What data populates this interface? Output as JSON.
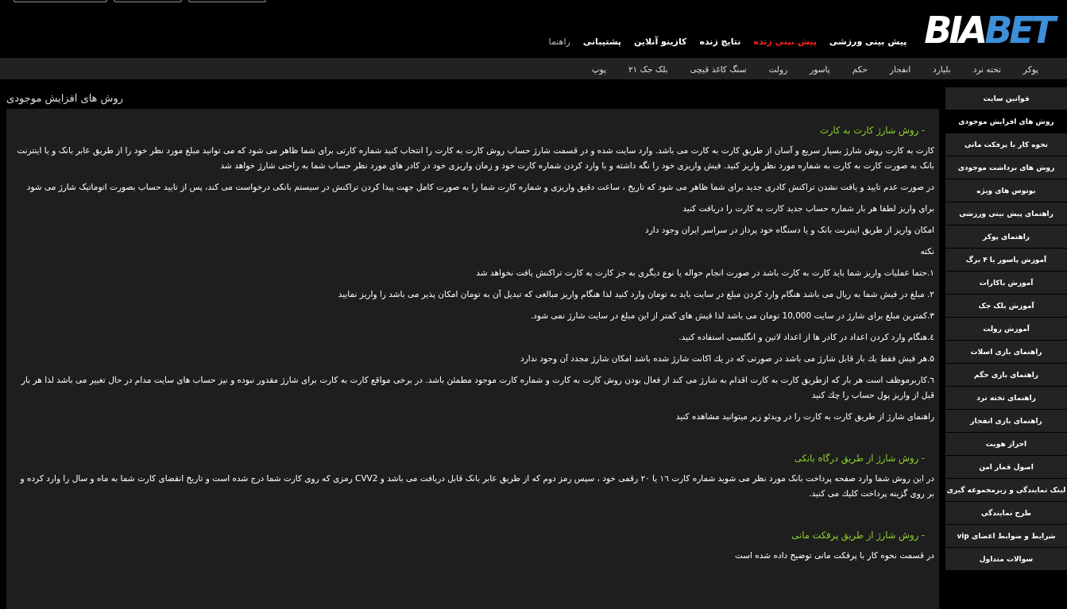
{
  "logo": {
    "first": "BIA",
    "second": "BET"
  },
  "top_buttons": [
    {
      "kind": "button"
    },
    {
      "kind": "button"
    },
    {
      "kind": "button"
    }
  ],
  "nav": [
    {
      "label": "پیش بینی ورزشی",
      "highlighted": false
    },
    {
      "label": "پیش بینی زنده",
      "highlighted": true
    },
    {
      "label": "نتایج زنده",
      "highlighted": false
    },
    {
      "label": "کازینو آنلاین",
      "highlighted": false
    },
    {
      "label": "پشتیبانی",
      "highlighted": false
    },
    {
      "label": "راهنما",
      "highlighted": false
    }
  ],
  "subnav": [
    "پوکر",
    "تخته نرد",
    "بلیارد",
    "انفجار",
    "حکم",
    "پاسور",
    "رولت",
    "سنگ کاغذ قیچی",
    "بلک جک ۲۱",
    "پوپ"
  ],
  "page_title": "روش های افزایش موجودی",
  "content": [
    {
      "kind": "heading",
      "text": "- روش شارژ کارت به کارت"
    },
    {
      "kind": "paragraph",
      "text": "کارت به کارت روش شارژ بسیار سریع و آسان از طریق کارت به کارت می باشد. وارد سایت شده و در قسمت شارژ حساب روش کارت به کارت  را انتخاب کنید شماره  کارتی برای شما ظاهر می شود که می توانید مبلغ مورد نظر خود را از طریق عابر بانک و یا اینترنت بانک به صورت کارت به کارت به شماره مورد نظر واریز کنید. فیش واریزی خود را نگه داشته و با وارد کردن شماره کارت خود و زمان واریزی خود در کادر های مورد نظر حساب شما به راحتی شارژ خواهد شد"
    },
    {
      "kind": "paragraph",
      "text": "در صورت عدم تایید و یافت نشدن تراکنش کادری جدید برای شما ظاهر می شود که تاریخ ، ساعت دقیق واریزی و شماره کارت شما را به صورت کامل جهت پیدا کردن تراکنش در سیستم بانکی درخواست می کند، پس از تایید حساب بصورت اتوماتیک شارژ می شود"
    },
    {
      "kind": "paragraph",
      "text": "برای واریز لطفا هر بار شماره حساب جدید کارت به کارت را دریافت کنید"
    },
    {
      "kind": "paragraph",
      "text": "امکان واریز از طریق اینترنت بانک و یا دستگاه خود پرداز در سراسر ایران وجود دارد"
    },
    {
      "kind": "paragraph",
      "text": "نکته"
    },
    {
      "kind": "paragraph",
      "text": "۱.حتما عملیات واریز شما باید کارت به کارت باشد در صورت انجام حواله یا نوع دیگری به جز کارت به کارت تراکنش یافت نخواهد شد"
    },
    {
      "kind": "paragraph",
      "text": "۲. مبلغ در فیش شما به ریال می باشد هنگام وارد کردن مبلغ در سایت باید به تومان وارد کنید لذا هنگام واریز مبالغی که تبدیل آن به تومان امکان پذیر می باشد را  واریز نمایید"
    },
    {
      "kind": "paragraph",
      "text": "۳.کمترین مبلغ برای شارژ در سایت 10,000 تومان می باشد لذا فیش های کمتر از این مبلغ در سایت شارژ نمی شود."
    },
    {
      "kind": "paragraph",
      "text": "٤.هنگام وارد کردن اعداد در کادر ها از اعداد لاتین و انگلیسی استفاده کنید."
    },
    {
      "kind": "paragraph",
      "text": "۵.هر فیش فقط یك بار قابل شارژ می باشد در صورتی که در یك اکانت شارژ شده باشد امکان شارژ مجدد آن وجود ندارد"
    },
    {
      "kind": "paragraph",
      "text": " ٦.کاربرموظف است هر بار که ازطریق کارت به کارت اقدام به شارژ می کند از فعال بودن روش  کارت به کارت و شماره کارت موجود مطمئن باشد. در برخی مواقع کارت به کارت  برای شارژ مقدور نبوده  و نیز حساب های سایت مدام در حال تغییر می باشد لذا هر بار قبل از واریز پول حساب را چك کنید"
    },
    {
      "kind": "paragraph",
      "text": "راهنمای شارژ از طریق کارت به کارت را در ویدئو زیر میتوانید مشاهده کنید"
    },
    {
      "kind": "spacer"
    },
    {
      "kind": "heading",
      "text": "- روش شارژ از طریق درگاه بانکی"
    },
    {
      "kind": "paragraph",
      "text": "در این روش شما وارد صفحه پرداخت بانک مورد نظر می شوید شماره کارت ۱٦ یا ۲۰ رقمی خود ، سپس رمز دوم که از طریق عابر بانک قابل دریافت می باشد و CVV2 رمزی که روی کارت شما درج شده است و تاریخ انقضای کارت شما به ماه و سال را وارد کرده و بر روی گزینه پرداخت کلیك می کنید."
    },
    {
      "kind": "spacer"
    },
    {
      "kind": "heading",
      "text": "- روش شارژ از طریق پرفکت مانی"
    },
    {
      "kind": "paragraph",
      "text": "در قسمت نحوه کار با پرفکت مانی توضیح داده شده است"
    }
  ],
  "sidebar": [
    {
      "label": "قوانین سایت",
      "selected": false
    },
    {
      "label": "روش های افزایش موجودی",
      "selected": true
    },
    {
      "label": "نحوه کار با پرفکت مانی",
      "selected": false
    },
    {
      "label": "روش های برداشت موجودی",
      "selected": false
    },
    {
      "label": "بونوس های ویژه",
      "selected": false
    },
    {
      "label": "راهنمای پیش بینی ورزشی",
      "selected": false
    },
    {
      "label": "راهنمای پوکر",
      "selected": false
    },
    {
      "label": "آموزش پاسور یا ۴ برگ",
      "selected": false
    },
    {
      "label": "آموزش باکارات",
      "selected": false
    },
    {
      "label": "آموزش بلک جک",
      "selected": false
    },
    {
      "label": "آموزش رولت",
      "selected": false
    },
    {
      "label": "راهنمای بازی اسلات",
      "selected": false
    },
    {
      "label": "راهنمای بازی حگم",
      "selected": false
    },
    {
      "label": "راهنمای تخته نرد",
      "selected": false
    },
    {
      "label": "راهنمای بازی انفجار",
      "selected": false
    },
    {
      "label": "احراز هویت",
      "selected": false
    },
    {
      "label": "اصول قمار امن",
      "selected": false
    },
    {
      "label": "لینک نمایندگی و زیرمجموعه گیری",
      "selected": false
    },
    {
      "label": "طرح نمایندگی",
      "selected": false
    },
    {
      "label": "شرایط و ضوابط اعضای vip",
      "selected": false
    },
    {
      "label": "سوالات متداول",
      "selected": false
    }
  ]
}
